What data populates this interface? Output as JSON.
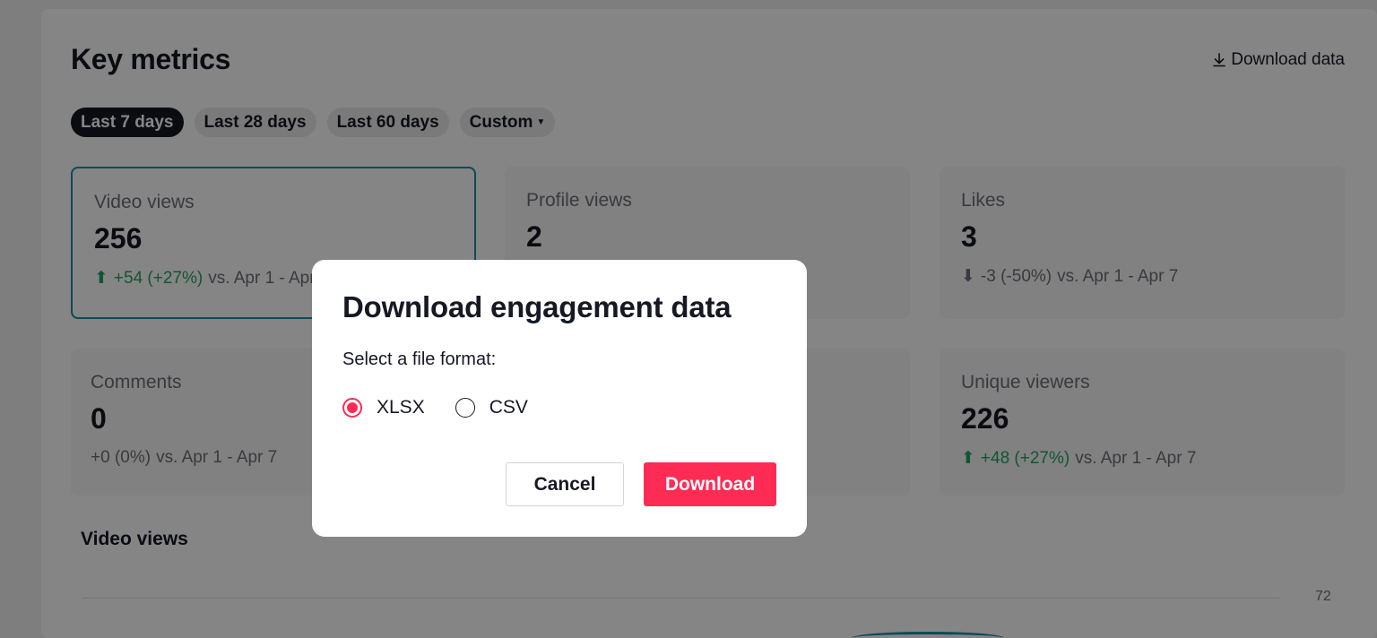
{
  "page": {
    "title": "Key metrics",
    "download_link": "Download data"
  },
  "filters": {
    "chips": [
      "Last 7 days",
      "Last 28 days",
      "Last 60 days",
      "Custom"
    ],
    "selected": "Last 7 days"
  },
  "metrics": [
    {
      "label": "Video views",
      "value": "256",
      "delta": "+54 (+27%)",
      "comparison": "vs.  Apr 1 - Apr 7",
      "trend": "up"
    },
    {
      "label": "Profile views",
      "value": "2",
      "delta": "",
      "comparison": "",
      "trend": ""
    },
    {
      "label": "Likes",
      "value": "3",
      "delta": "-3 (-50%)",
      "comparison": "vs.  Apr 1 - Apr 7",
      "trend": "down"
    },
    {
      "label": "Comments",
      "value": "0",
      "delta": "+0 (0%)",
      "comparison": "vs.  Apr 1 - Apr 7",
      "trend": "flat"
    },
    {
      "label": "Unique viewers",
      "value": "226",
      "delta": "+48 (+27%)",
      "comparison": "vs.  Apr 1 - Apr 7",
      "trend": "up"
    }
  ],
  "chart": {
    "title": "Video views",
    "y_tick": "72"
  },
  "modal": {
    "title": "Download engagement data",
    "prompt": "Select a file format:",
    "options": [
      "XLSX",
      "CSV"
    ],
    "selected_option": "XLSX",
    "cancel_label": "Cancel",
    "download_label": "Download"
  },
  "colors": {
    "accent": "#fe2c55",
    "selected_card_border": "#1a8fa8",
    "positive": "#25a460"
  }
}
